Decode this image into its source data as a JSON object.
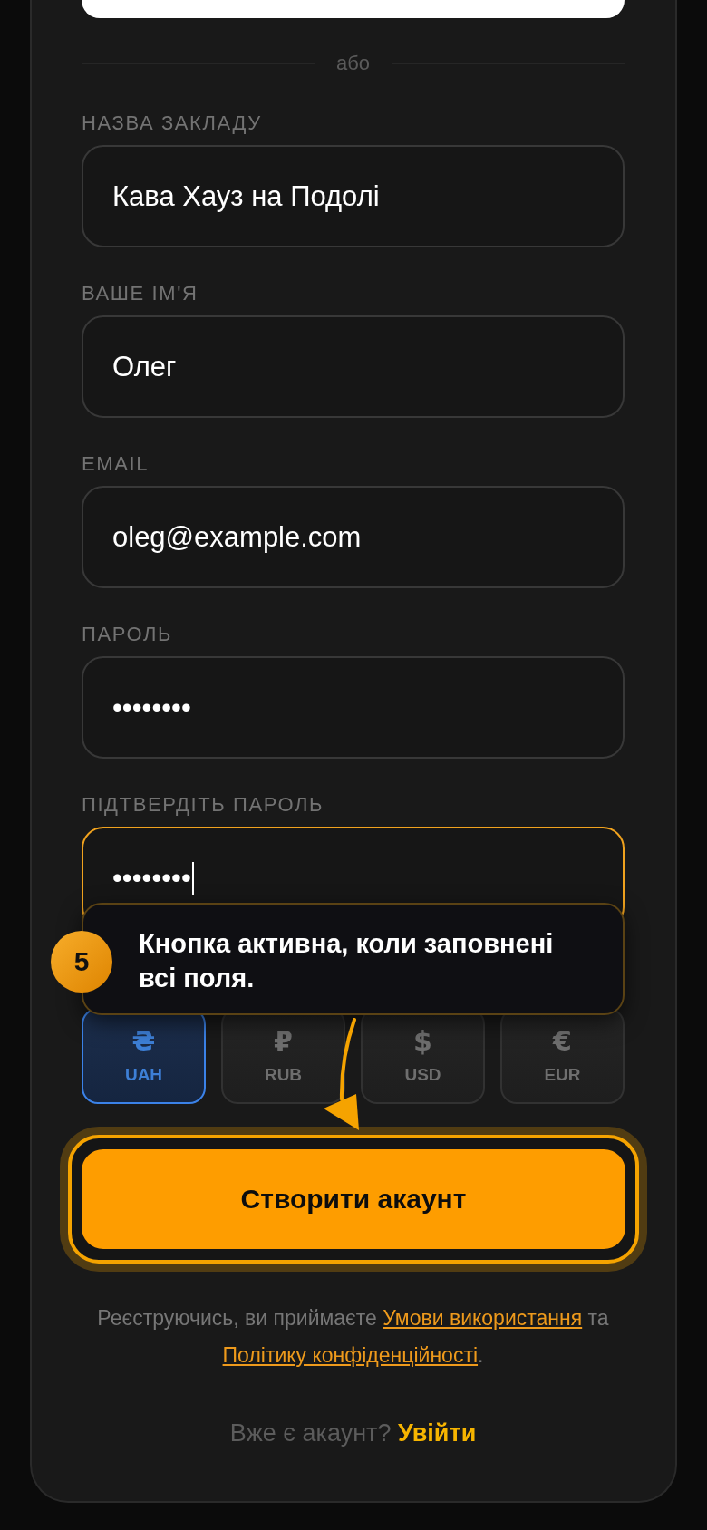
{
  "divider": {
    "text": "або"
  },
  "fields": [
    {
      "label": "НАЗВА ЗАКЛАДУ",
      "value": "Кава Хауз на Подолі",
      "focused": false
    },
    {
      "label": "ВАШЕ ІМ'Я",
      "value": "Олег",
      "focused": false
    },
    {
      "label": "EMAIL",
      "value": "oleg@example.com",
      "focused": false
    },
    {
      "label": "ПАРОЛЬ",
      "value": "••••••••",
      "focused": false
    },
    {
      "label": "ПІДТВЕРДІТЬ ПАРОЛЬ",
      "value": "••••••••",
      "focused": true
    }
  ],
  "tutorial": {
    "step": "5",
    "text": "Кнопка активна, коли заповнені всі поля."
  },
  "currencies": [
    {
      "symbol": "₴",
      "code": "UAH",
      "selected": true
    },
    {
      "symbol": "₽",
      "code": "RUB",
      "selected": false
    },
    {
      "symbol": "$",
      "code": "USD",
      "selected": false
    },
    {
      "symbol": "€",
      "code": "EUR",
      "selected": false
    }
  ],
  "submit": {
    "label": "Створити акаунт",
    "highlighted": true
  },
  "terms": {
    "before": "Реєструючись, ви приймаєте",
    "terms_link": "Умови використання",
    "middle": "та",
    "privacy_link": "Політику конфіденційності",
    "after": "."
  },
  "login": {
    "prompt": "Вже є акаунт?",
    "link": "Увійти"
  }
}
